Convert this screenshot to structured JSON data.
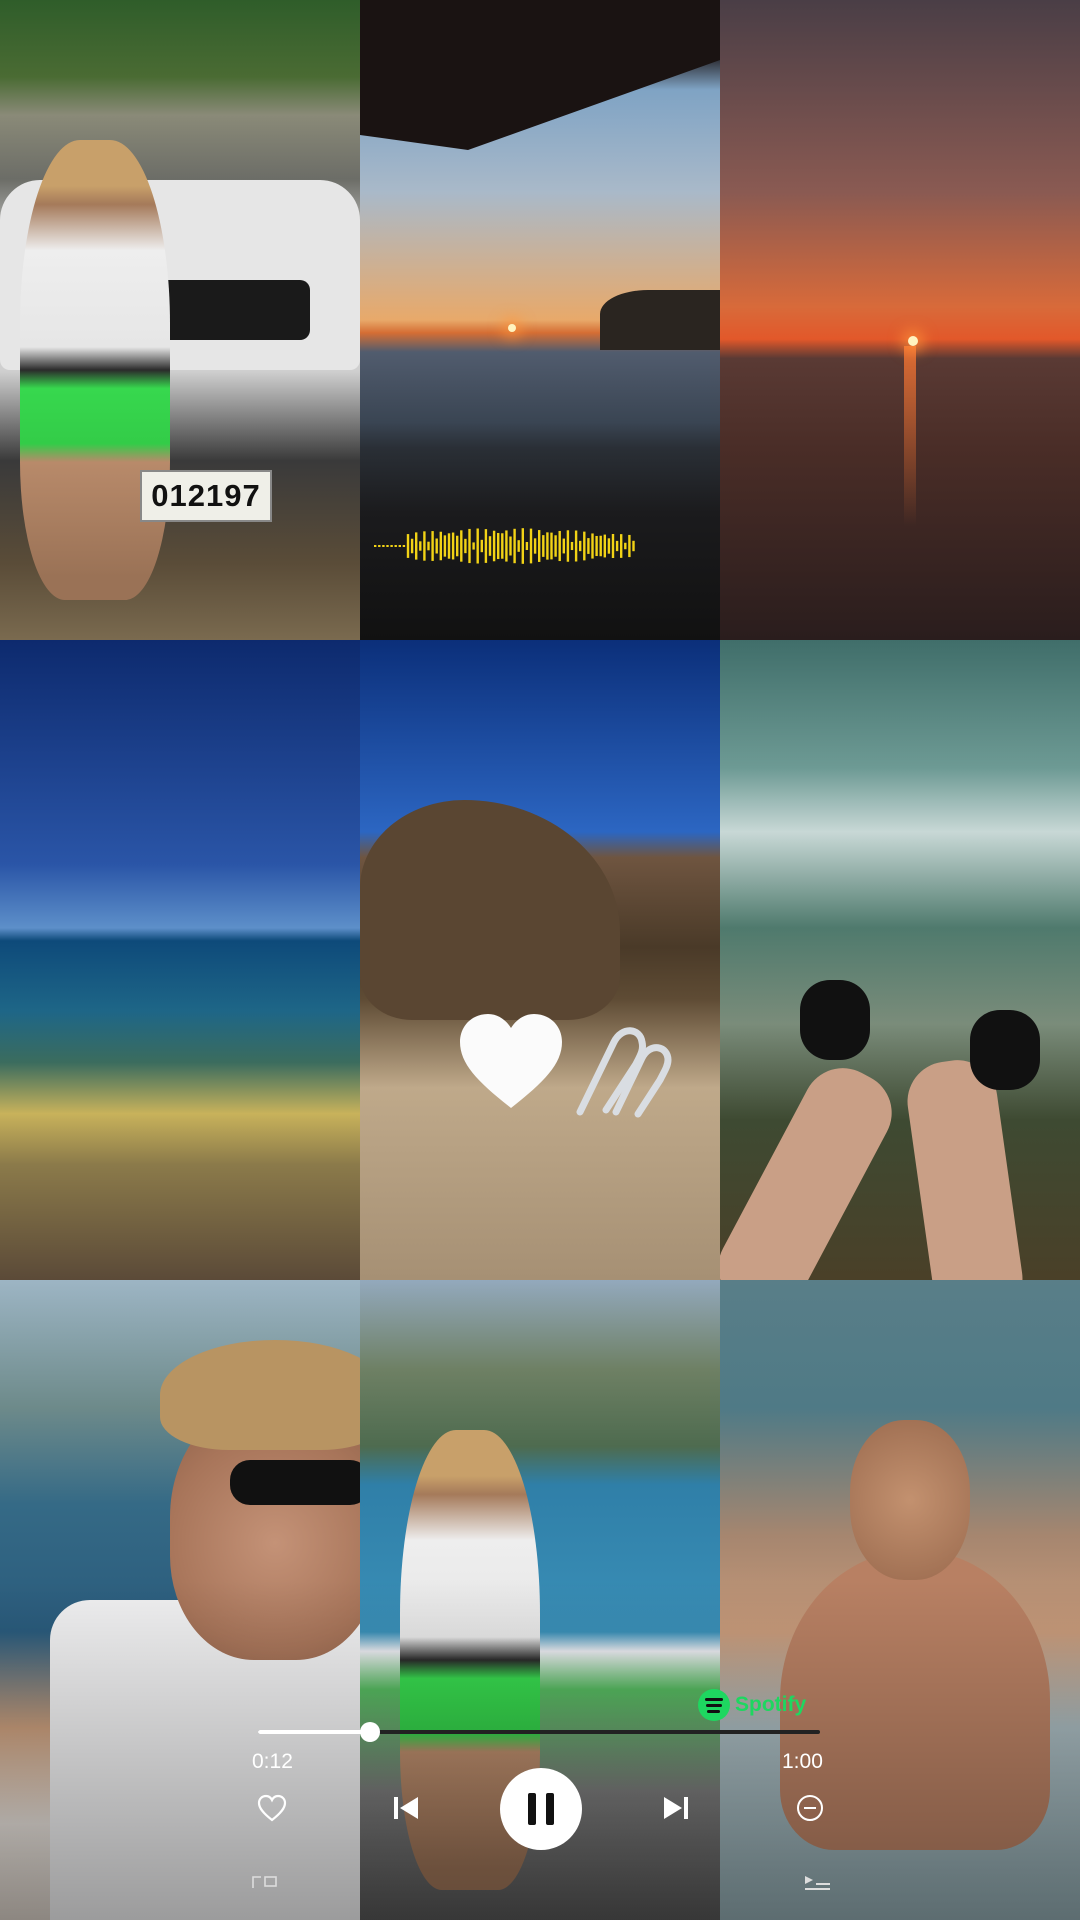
{
  "collage": {
    "car_plate": "012197"
  },
  "player": {
    "brand": "Spotify",
    "elapsed": "0:12",
    "duration": "1:00",
    "progress_fraction": 0.2
  },
  "icons": {
    "like": "heart-outline-icon",
    "previous": "skip-previous-icon",
    "pause": "pause-icon",
    "next": "skip-next-icon",
    "hide": "minus-circle-icon",
    "share_left": "share-frame-icon",
    "share_right": "queue-icon",
    "brand": "spotify-logo-icon"
  },
  "colors": {
    "spotify_green": "#1ed760",
    "waveform_yellow": "#f2d316"
  }
}
